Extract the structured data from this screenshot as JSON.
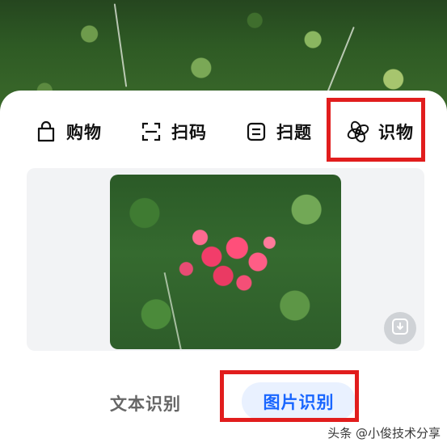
{
  "tabs": [
    {
      "id": "shop",
      "label": "购物",
      "icon": "shopping-bag-icon"
    },
    {
      "id": "scan",
      "label": "扫码",
      "icon": "scan-frame-icon"
    },
    {
      "id": "question",
      "label": "扫题",
      "icon": "question-card-icon"
    },
    {
      "id": "identify",
      "label": "识物",
      "icon": "identify-leaf-icon"
    }
  ],
  "modes": {
    "text_label": "文本识别",
    "image_label": "图片识别"
  },
  "watermark": "头条 @小俊技术分享",
  "colors": {
    "highlight_red": "#e11d1d",
    "accent_blue": "#1966ff",
    "panel_bg": "#f2f3f5"
  },
  "icons": {
    "save": "download-icon"
  }
}
